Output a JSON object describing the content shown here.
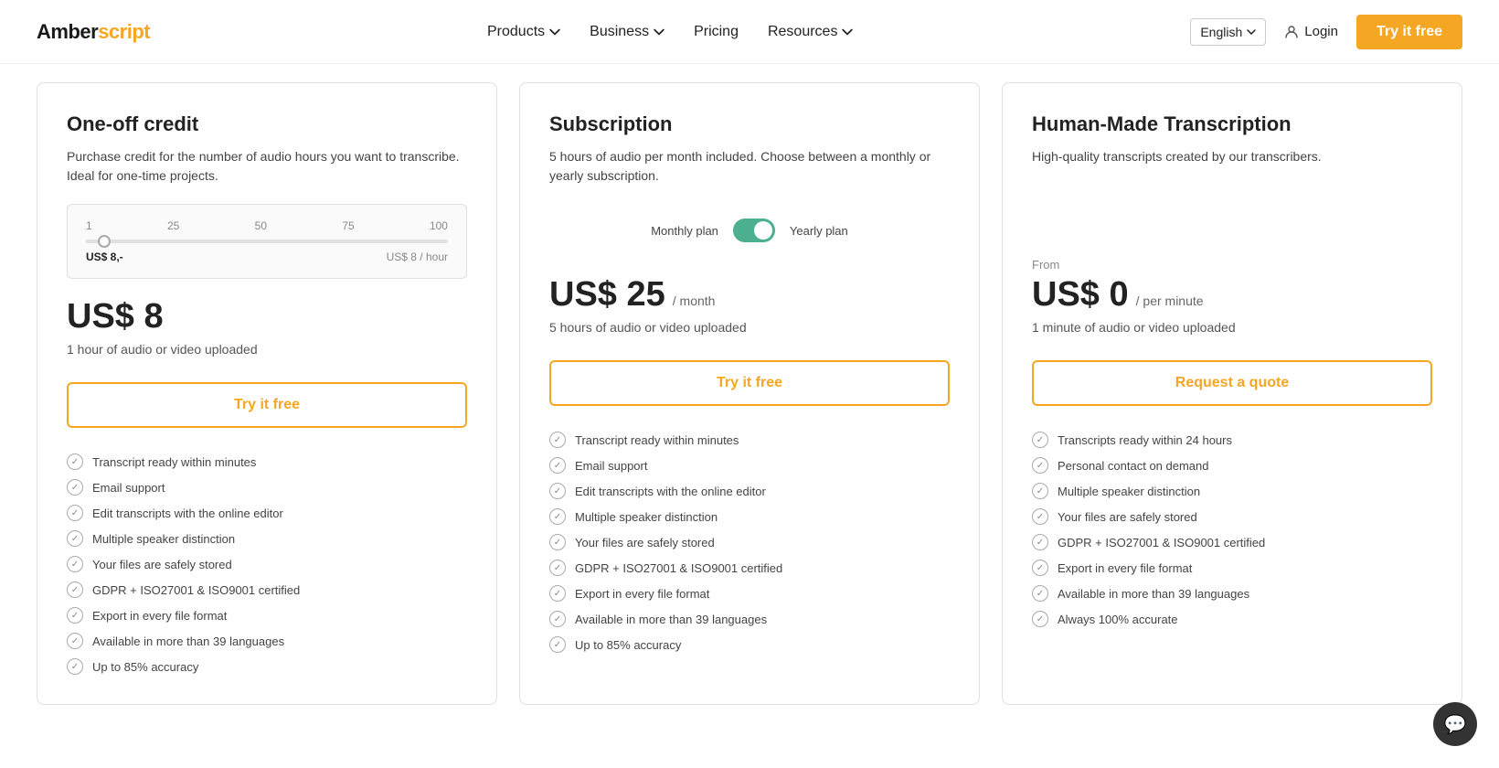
{
  "brand": {
    "name_part1": "Amber",
    "name_part2": "script"
  },
  "nav": {
    "links": [
      {
        "label": "Products",
        "hasDropdown": true
      },
      {
        "label": "Business",
        "hasDropdown": true
      },
      {
        "label": "Pricing",
        "hasDropdown": false
      },
      {
        "label": "Resources",
        "hasDropdown": true
      }
    ],
    "language": "English",
    "login_label": "Login",
    "cta_label": "Try it free"
  },
  "plans": [
    {
      "id": "one-off",
      "title": "One-off credit",
      "description": "Purchase credit for the number of audio hours you want to transcribe. Ideal for one-time projects.",
      "has_slider": true,
      "slider_labels": [
        "1",
        "25",
        "50",
        "75",
        "100"
      ],
      "slider_price_label": "US$ 8,-",
      "slider_unit_label": "US$ 8 / hour",
      "price_from": null,
      "price_amount": "US$ 8",
      "price_period": null,
      "price_desc": "1 hour of audio or video uploaded",
      "cta_label": "Try it free",
      "features": [
        "Transcript ready within minutes",
        "Email support",
        "Edit transcripts with the online editor",
        "Multiple speaker distinction",
        "Your files are safely stored",
        "GDPR + ISO27001 & ISO9001 certified",
        "Export in every file format",
        "Available in more than 39 languages",
        "Up to 85% accuracy"
      ]
    },
    {
      "id": "subscription",
      "title": "Subscription",
      "description": "5 hours of audio per month included. Choose between a monthly or yearly subscription.",
      "has_toggle": true,
      "toggle_left": "Monthly plan",
      "toggle_right": "Yearly plan",
      "price_from": null,
      "price_amount": "US$ 25",
      "price_period": "/ month",
      "price_desc": "5 hours of audio or video uploaded",
      "cta_label": "Try it free",
      "features": [
        "Transcript ready within minutes",
        "Email support",
        "Edit transcripts with the online editor",
        "Multiple speaker distinction",
        "Your files are safely stored",
        "GDPR + ISO27001 & ISO9001 certified",
        "Export in every file format",
        "Available in more than 39 languages",
        "Up to 85% accuracy"
      ]
    },
    {
      "id": "human-made",
      "title": "Human-Made Transcription",
      "description": "High-quality transcripts created by our transcribers.",
      "price_from": "From",
      "price_amount": "US$ 0",
      "price_period": "/ per minute",
      "price_desc": "1 minute of audio or video uploaded",
      "cta_label": "Request a quote",
      "features": [
        "Transcripts ready within 24 hours",
        "Personal contact on demand",
        "Multiple speaker distinction",
        "Your files are safely stored",
        "GDPR + ISO27001 & ISO9001 certified",
        "Export in every file format",
        "Available in more than 39 languages",
        "Always 100% accurate"
      ]
    }
  ]
}
